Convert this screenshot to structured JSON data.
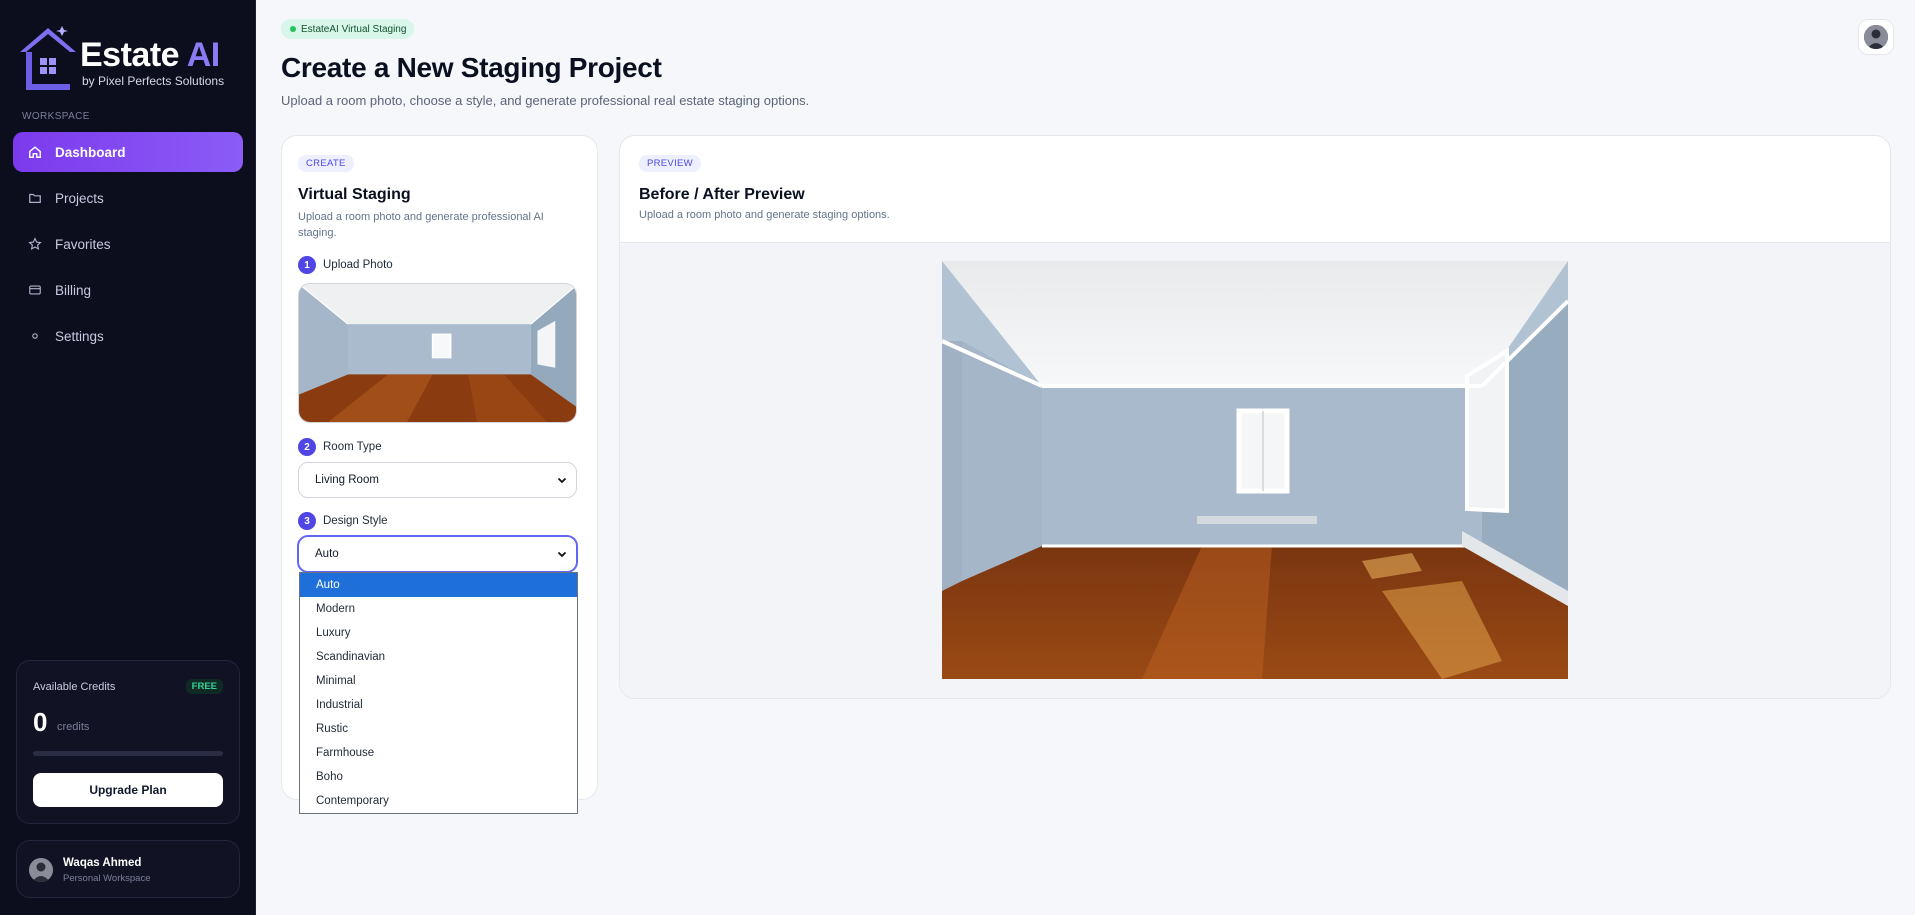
{
  "brand": {
    "name": "Estate",
    "name_accent": "AI",
    "tagline": "by Pixel Perfects Solutions"
  },
  "sidebar": {
    "section_label": "WORKSPACE",
    "items": [
      {
        "label": "Dashboard",
        "icon": "home-icon",
        "active": true
      },
      {
        "label": "Projects",
        "icon": "folder-icon",
        "active": false
      },
      {
        "label": "Favorites",
        "icon": "star-icon",
        "active": false
      },
      {
        "label": "Billing",
        "icon": "card-icon",
        "active": false
      },
      {
        "label": "Settings",
        "icon": "settings-dot-icon",
        "active": false
      }
    ],
    "credits": {
      "title": "Available Credits",
      "plan_badge": "FREE",
      "count": "0",
      "unit": "credits",
      "progress": 0,
      "upgrade_label": "Upgrade Plan"
    },
    "user": {
      "name": "Waqas Ahmed",
      "role": "Personal Workspace"
    }
  },
  "header": {
    "pill": "EstateAI Virtual Staging",
    "title": "Create a New Staging Project",
    "subtitle": "Upload a room photo, choose a style, and generate professional real estate staging options."
  },
  "create": {
    "tag": "CREATE",
    "title": "Virtual Staging",
    "description": "Upload a room photo and generate professional AI staging.",
    "steps": [
      {
        "num": "1",
        "label": "Upload Photo"
      },
      {
        "num": "2",
        "label": "Room Type"
      },
      {
        "num": "3",
        "label": "Design Style"
      }
    ],
    "room_type": "Living Room",
    "design_style": "Auto",
    "style_options": [
      "Auto",
      "Modern",
      "Luxury",
      "Scandinavian",
      "Minimal",
      "Industrial",
      "Rustic",
      "Farmhouse",
      "Boho",
      "Contemporary"
    ]
  },
  "preview": {
    "tag": "PREVIEW",
    "title": "Before / After Preview",
    "description": "Upload a room photo and generate staging options."
  },
  "colors": {
    "accent": "#7c3aed",
    "step": "#4f46e5",
    "selected_option": "#1e6fd9",
    "success": "#22c55e"
  }
}
